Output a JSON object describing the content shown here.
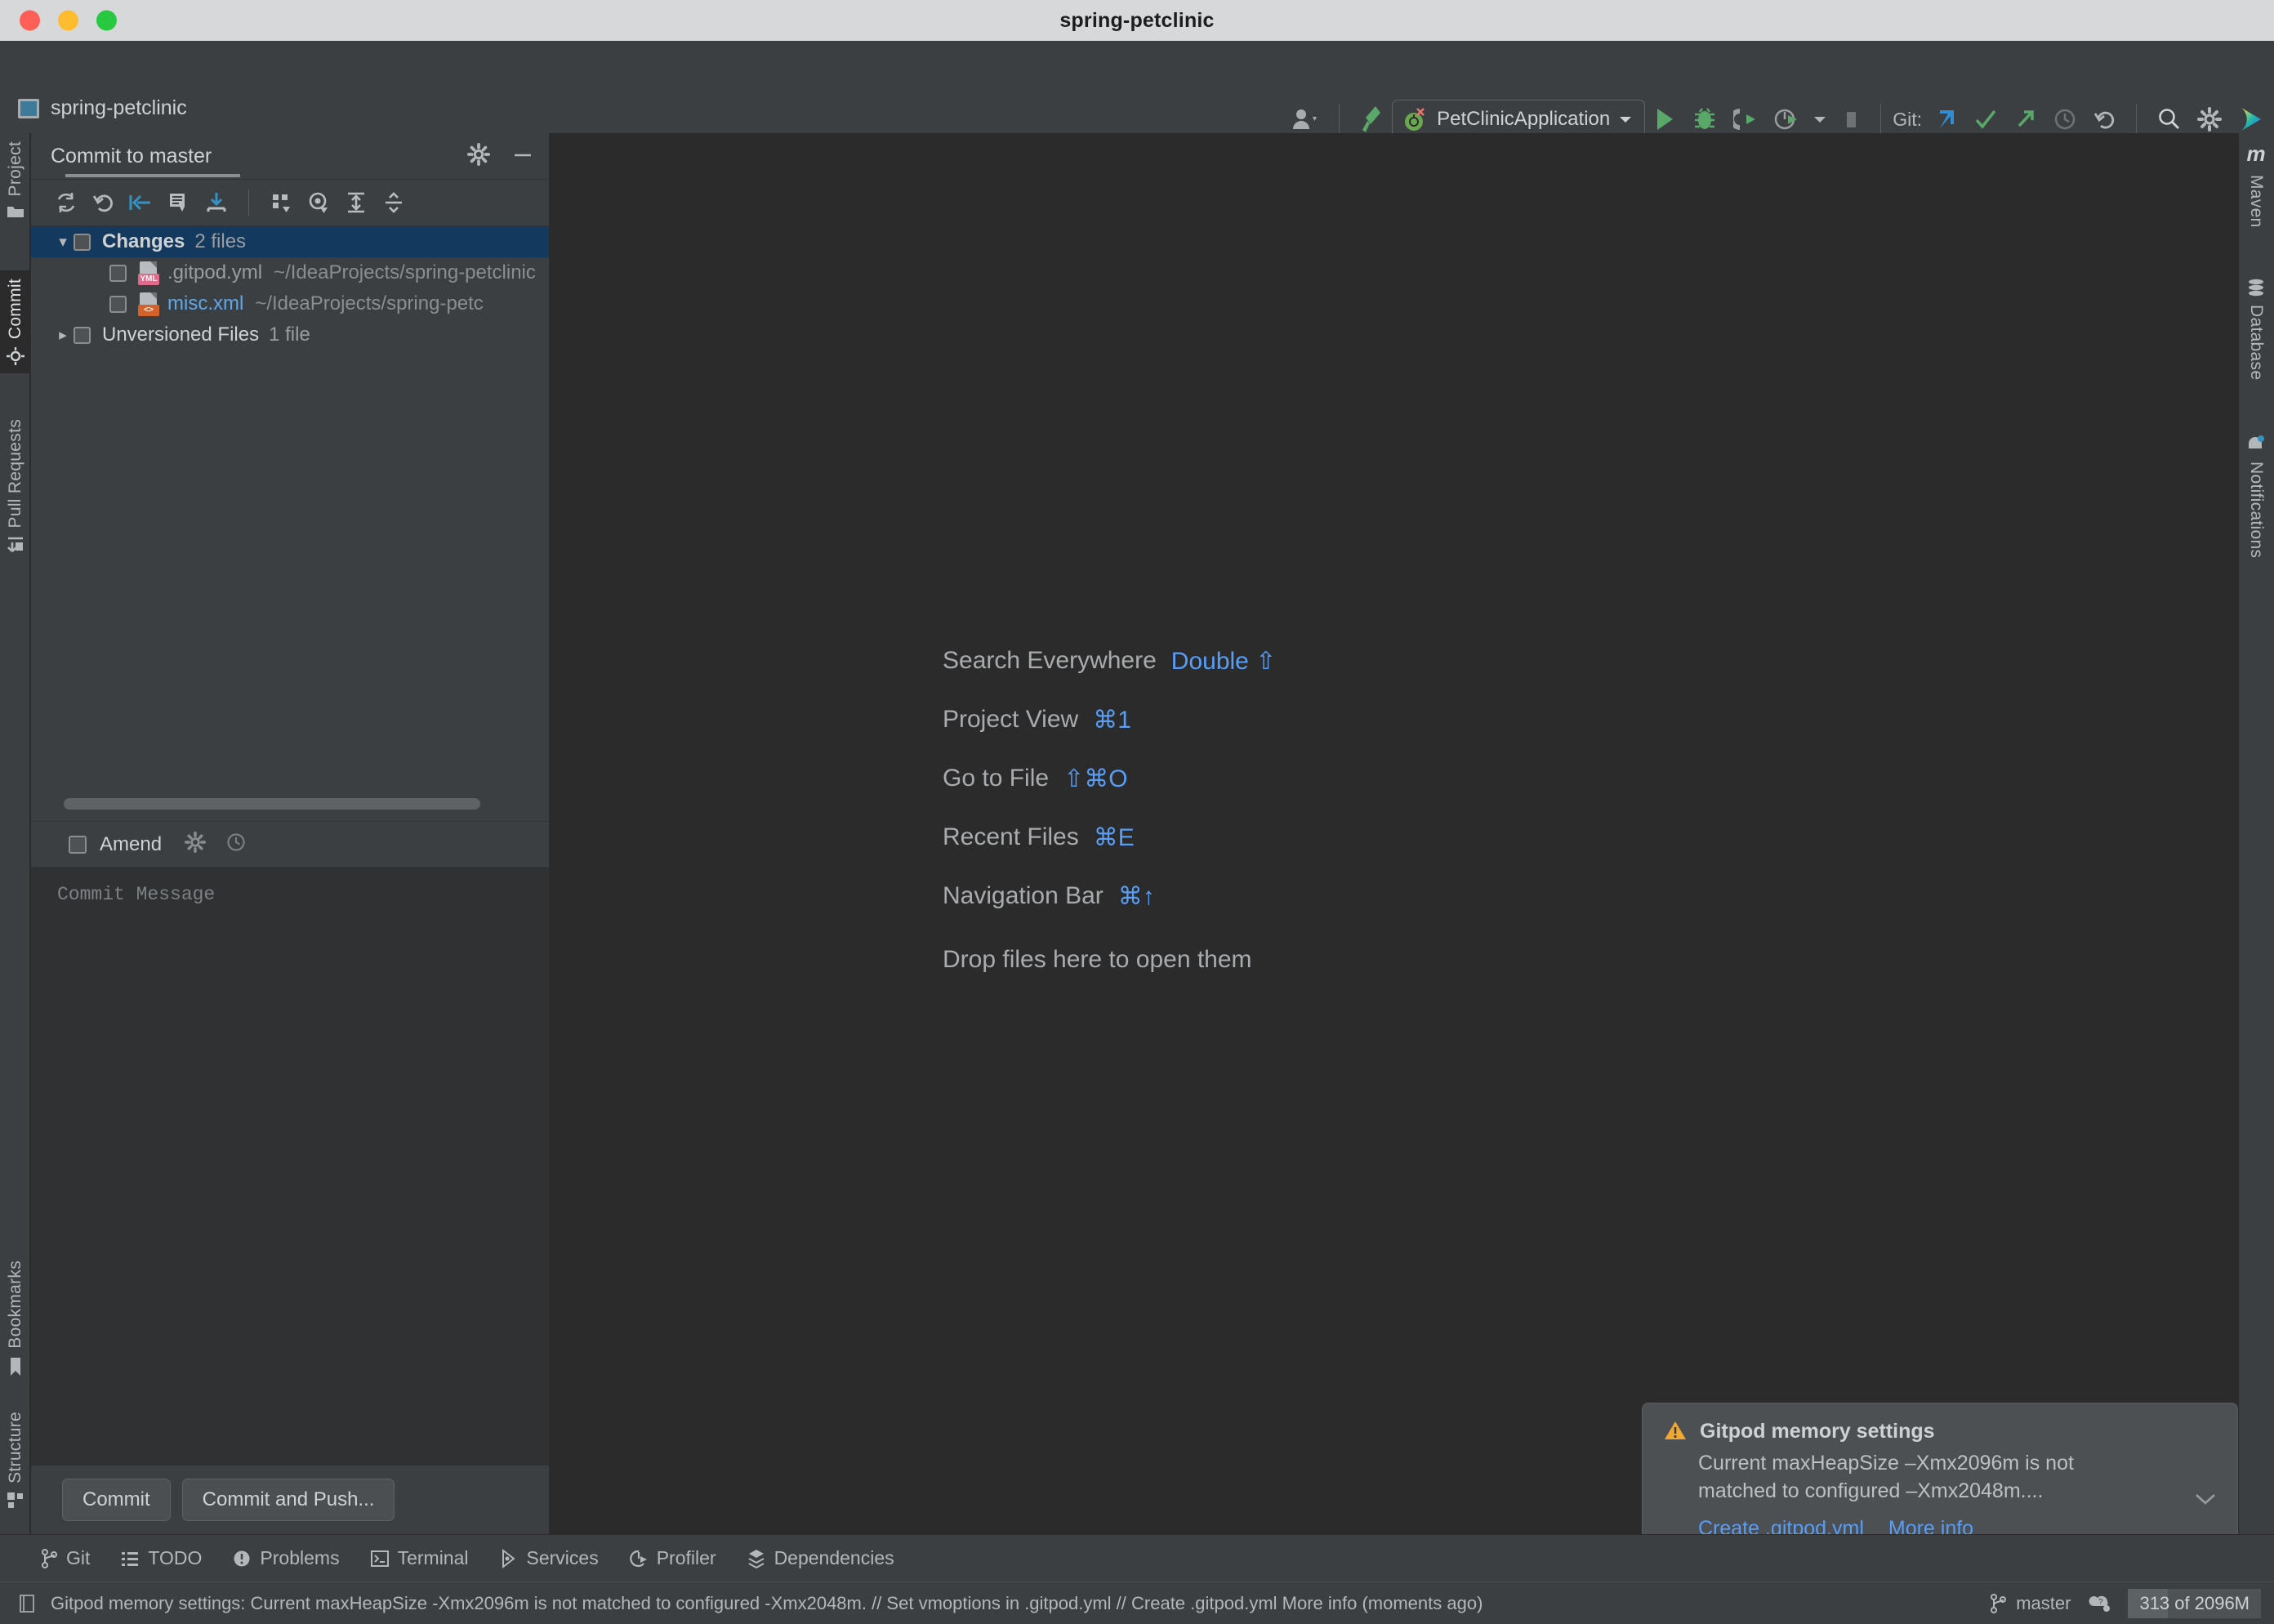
{
  "window": {
    "title": "spring-petclinic",
    "traffic_lights": [
      "close-red",
      "minimize-yellow",
      "zoom-green"
    ]
  },
  "header": {
    "project_name": "spring-petclinic",
    "project_icon": "project-window-icon",
    "toolbar": {
      "user_icon": "user-avatar-icon",
      "build_icon": "build-hammer-icon",
      "run_config": {
        "label": "PetClinicApplication",
        "icon": "spring-boot-icon",
        "dropdown": "chevron-down-icon"
      },
      "run_icon": "run-play-icon",
      "debug_icon": "debug-bug-icon",
      "run_coverage_icon": "run-with-coverage-icon",
      "profile_icon": "profiler-icon",
      "stop_icon": "stop-square-icon",
      "git_label": "Git:",
      "git_update_icon": "update-project-icon",
      "git_commit_icon": "commit-checkmark-icon",
      "git_push_icon": "push-arrow-icon",
      "git_history_icon": "history-clock-icon",
      "git_rollback_icon": "rollback-undo-icon",
      "search_icon": "search-magnifier-icon",
      "settings_icon": "gear-settings-icon",
      "ide_logo_icon": "intellij-idea-logo-icon"
    }
  },
  "left_strip": [
    {
      "label": "Project",
      "icon": "project-folder-icon",
      "selected": false
    },
    {
      "label": "Commit",
      "icon": "commit-icon",
      "selected": true
    },
    {
      "label": "Pull Requests",
      "icon": "pull-request-icon",
      "selected": false
    },
    {
      "label": "Bookmarks",
      "icon": "bookmark-icon",
      "selected": false
    },
    {
      "label": "Structure",
      "icon": "structure-icon",
      "selected": false
    }
  ],
  "right_strip": [
    {
      "label": "Maven",
      "icon": "maven-m-icon"
    },
    {
      "label": "Database",
      "icon": "database-icon"
    },
    {
      "label": "Notifications",
      "icon": "notifications-bell-icon"
    }
  ],
  "commit_panel": {
    "title": "Commit to master",
    "settings_icon": "gear-icon",
    "minimize_icon": "minimize-icon",
    "toolbar_icons": [
      "refresh-changes-icon",
      "rollback-icon",
      "shelve-silently-icon",
      "show-diff-icon",
      "get-from-vcs-icon",
      "group-by-icon",
      "preview-diff-icon",
      "expand-all-icon",
      "collapse-all-icon"
    ],
    "tree": [
      {
        "type": "group",
        "label": "Changes",
        "count": "2 files",
        "expanded": true,
        "selected": true
      },
      {
        "type": "file",
        "name": ".gitpod.yml",
        "path": "~/IdeaProjects/spring-petclinic",
        "badge": "YML",
        "badge_color": "#e06c8c",
        "name_color": "grey",
        "icon": "yaml-file-icon"
      },
      {
        "type": "file",
        "name": "misc.xml",
        "path": "~/IdeaProjects/spring-petc",
        "badge": "<>",
        "badge_color": "#d4622a",
        "name_color": "blue",
        "icon": "xml-file-icon"
      },
      {
        "type": "group",
        "label": "Unversioned Files",
        "count": "1 file",
        "expanded": false,
        "selected": false
      }
    ],
    "amend": {
      "label": "Amend",
      "checked": false,
      "settings_icon": "gear-icon",
      "history_icon": "clock-history-icon"
    },
    "commit_message_placeholder": "Commit Message",
    "buttons": [
      {
        "label": "Commit",
        "name": "commit-button"
      },
      {
        "label": "Commit and Push...",
        "name": "commit-and-push-button"
      }
    ]
  },
  "editor": {
    "shortcuts": [
      {
        "label": "Search Everywhere",
        "keys": "Double ⇧"
      },
      {
        "label": "Project View",
        "keys": "⌘1"
      },
      {
        "label": "Go to File",
        "keys": "⇧⌘O"
      },
      {
        "label": "Recent Files",
        "keys": "⌘E"
      },
      {
        "label": "Navigation Bar",
        "keys": "⌘↑"
      }
    ],
    "drop_hint": "Drop files here to open them"
  },
  "notification": {
    "warning_icon": "warning-triangle-icon",
    "title": "Gitpod memory settings",
    "body": "Current maxHeapSize –Xmx2096m is not matched to configured –Xmx2048m....",
    "links": [
      {
        "label": "Create .gitpod.yml"
      },
      {
        "label": "More info"
      }
    ],
    "collapse_icon": "chevron-down-icon"
  },
  "bottom_bar": [
    {
      "label": "Git",
      "icon": "git-branch-icon"
    },
    {
      "label": "TODO",
      "icon": "todo-list-icon"
    },
    {
      "label": "Problems",
      "icon": "problems-icon"
    },
    {
      "label": "Terminal",
      "icon": "terminal-icon"
    },
    {
      "label": "Services",
      "icon": "services-icon"
    },
    {
      "label": "Profiler",
      "icon": "profiler-icon"
    },
    {
      "label": "Dependencies",
      "icon": "dependencies-icon"
    }
  ],
  "status_bar": {
    "event_icon": "event-log-icon",
    "message": "Gitpod memory settings: Current maxHeapSize -Xmx2096m is not matched to configured -Xmx2048m. // Set vmoptions in .gitpod.yml // Create .gitpod.yml   More info (moments ago)",
    "branch_icon": "git-branch-icon",
    "branch": "master",
    "inspection_icon": "inspection-widget-icon",
    "memory": "313 of 2096M"
  },
  "colors": {
    "titlebar_bg": "#d6d8da",
    "chrome_bg": "#3c3f41",
    "editor_bg": "#2b2b2b",
    "accent_blue": "#589df6",
    "selection_blue": "#133a5e",
    "text": "#cfd2d4",
    "muted_text": "#9a9d9f",
    "warning": "#f0a732",
    "green": "#59a869"
  }
}
